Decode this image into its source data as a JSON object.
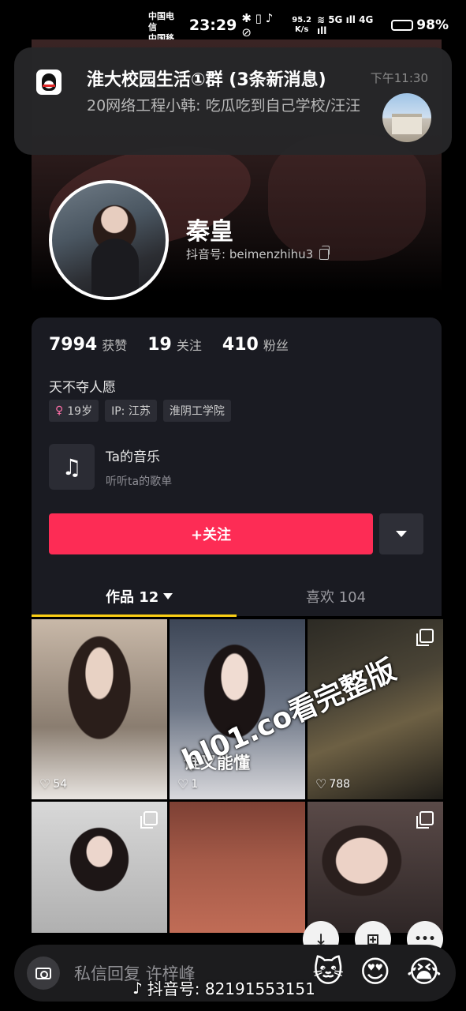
{
  "status_bar": {
    "carrier1": "中国电信",
    "carrier2": "中国移动",
    "time": "23:29",
    "icons": "✱ ▯ ♪ ⊘",
    "speed_value": "95.2",
    "speed_unit": "K/s",
    "network": "≋ 5G ıll 4G ıll",
    "battery_percent": "98%",
    "battery_level": 0.98
  },
  "notification": {
    "app_icon": "qq-icon",
    "title": "淮大校园生活①群 (3条新消息)",
    "time": "下午11:30",
    "body": "20网络工程小韩: 吃瓜吃到自己学校/汪汪"
  },
  "profile": {
    "name": "秦皇",
    "id_label": "抖音号: beimenzhihu3"
  },
  "stats": {
    "likes_value": "7994",
    "likes_label": "获赞",
    "following_value": "19",
    "following_label": "关注",
    "followers_value": "410",
    "followers_label": "粉丝"
  },
  "bio": "天不夺人愿",
  "tags": {
    "age": "19岁",
    "ip": "IP: 江苏",
    "school": "淮阴工学院",
    "gender_icon": "♀"
  },
  "music": {
    "icon": "♫",
    "title": "Ta的音乐",
    "subtitle": "听听ta的歌单"
  },
  "follow_button": "+关注",
  "tabs": {
    "works": "作品 12",
    "likes": "喜欢 104"
  },
  "grid": {
    "items": [
      {
        "likes": "54"
      },
      {
        "likes": "1",
        "caption": "谁又能懂"
      },
      {
        "likes": "788"
      }
    ]
  },
  "watermark": "hl01.co看完整版",
  "floating_buttons": {
    "download": "⤓",
    "apps": "⊞",
    "more": "•••"
  },
  "bottom_bar": {
    "placeholder": "私信回复 许梓峰",
    "emojis": [
      "🐱",
      "😍",
      "😭"
    ]
  },
  "douyin_id": "抖音号: 82191553151",
  "icons": {
    "heart": "♡",
    "tiktok": "♪"
  }
}
